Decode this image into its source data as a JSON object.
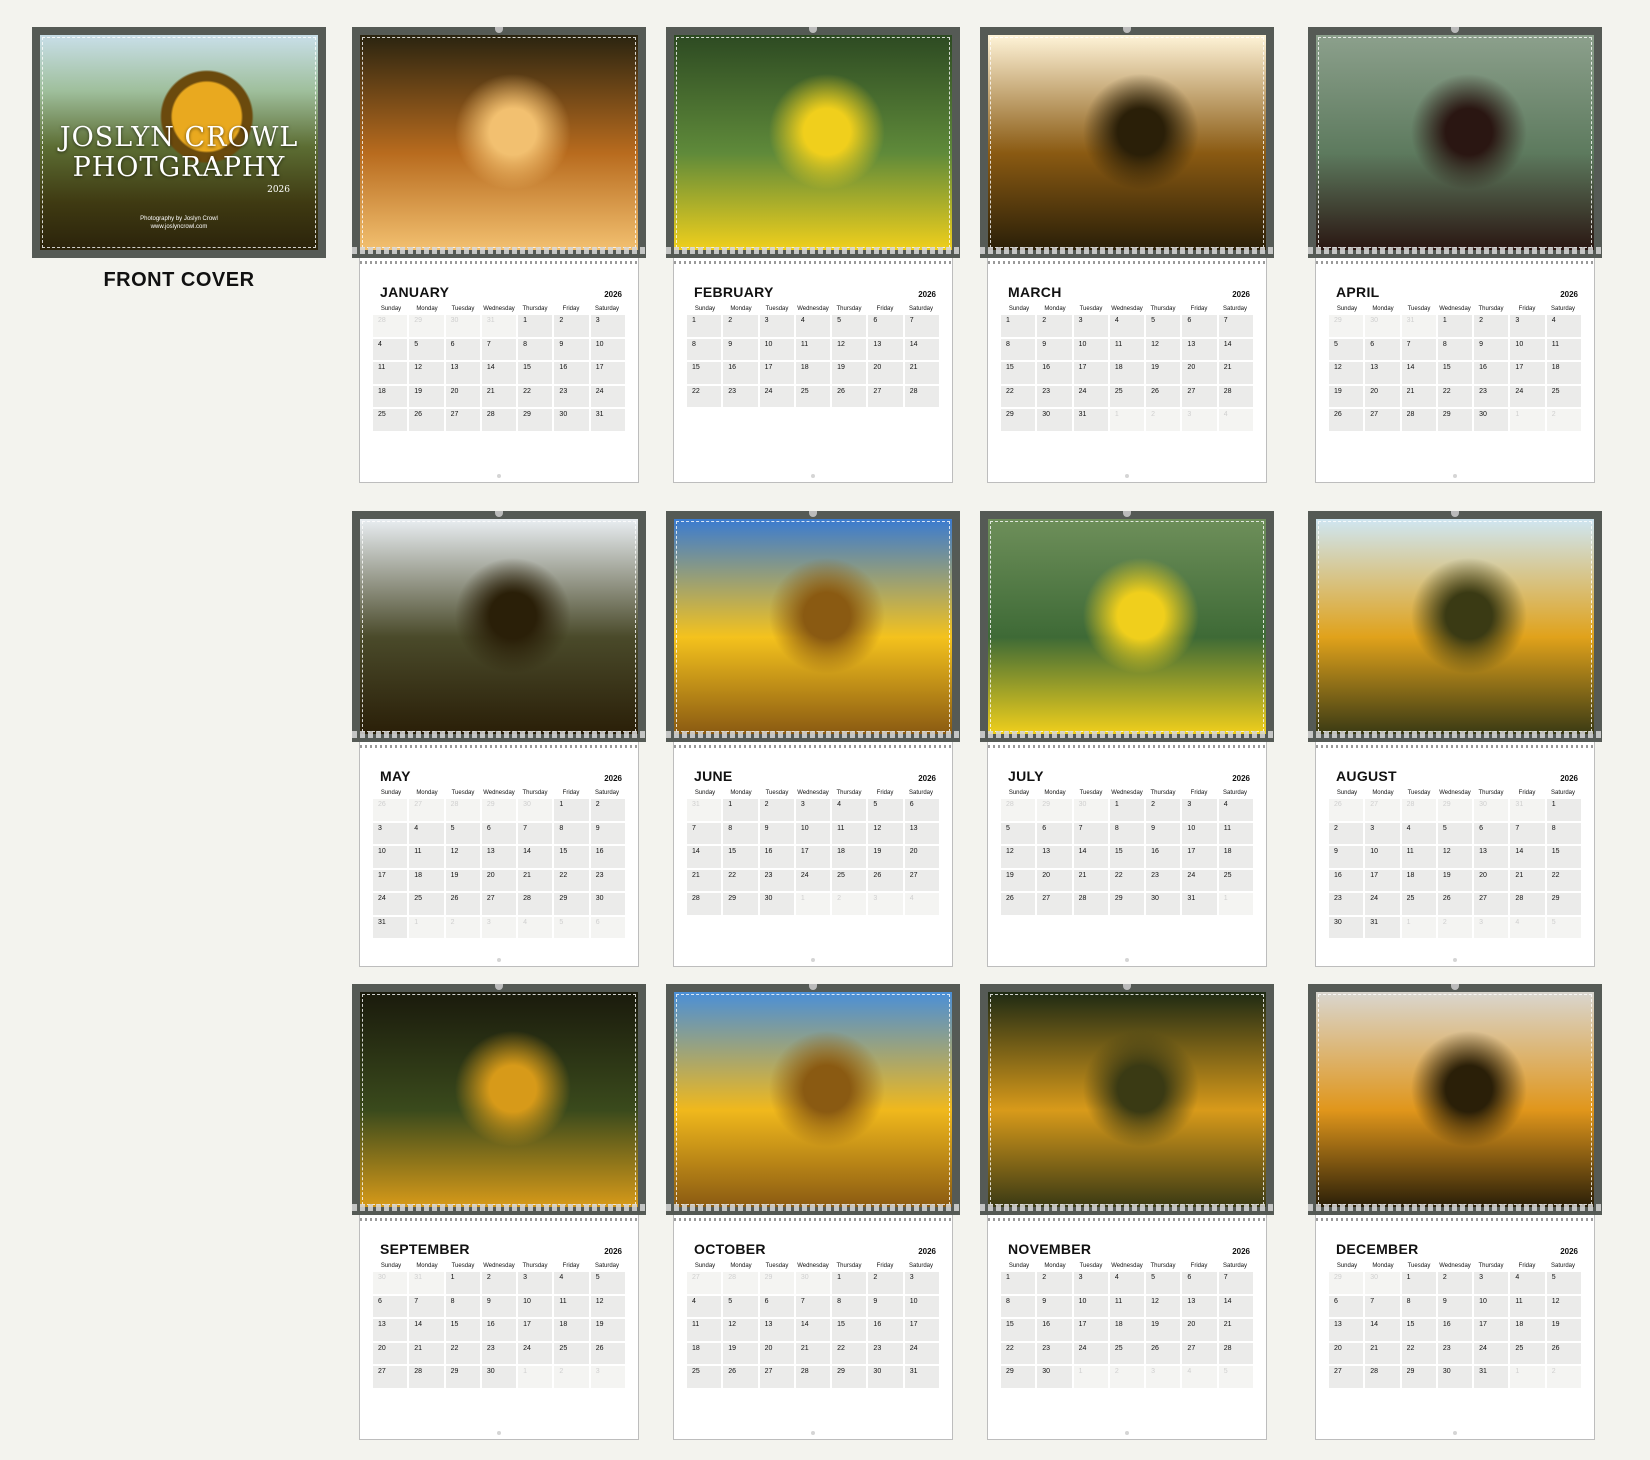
{
  "cover": {
    "title_line1": "JOSLYN CROWL",
    "title_line2": "PHOTGRAPHY",
    "year": "2026",
    "credit_line1": "Photography by Joslyn Crowl",
    "credit_line2": "www.joslyncrowl.com",
    "label": "FRONT COVER"
  },
  "weekdays": [
    "Sunday",
    "Monday",
    "Tuesday",
    "Wednesday",
    "Thursday",
    "Friday",
    "Saturday"
  ],
  "year": "2026",
  "months": [
    {
      "name": "JANUARY",
      "start": 4,
      "days": 31,
      "prev": 31,
      "photo": [
        "#2a2410",
        "#b86b1e",
        "#f2c070"
      ]
    },
    {
      "name": "FEBRUARY",
      "start": 0,
      "days": 28,
      "prev": 31,
      "photo": [
        "#2d4a22",
        "#5f8a3a",
        "#f0cf1c"
      ]
    },
    {
      "name": "MARCH",
      "start": 0,
      "days": 31,
      "prev": 28,
      "photo": [
        "#fff4d8",
        "#8a5a12",
        "#2a1f08"
      ]
    },
    {
      "name": "APRIL",
      "start": 3,
      "days": 30,
      "prev": 31,
      "photo": [
        "#8ca08c",
        "#5d7a5e",
        "#2a1612"
      ]
    },
    {
      "name": "MAY",
      "start": 5,
      "days": 31,
      "prev": 30,
      "photo": [
        "#e9eef2",
        "#4a4a2a",
        "#2a1f08"
      ]
    },
    {
      "name": "JUNE",
      "start": 1,
      "days": 30,
      "prev": 31,
      "photo": [
        "#3a7bd1",
        "#f4c21d",
        "#8a5a12"
      ]
    },
    {
      "name": "JULY",
      "start": 3,
      "days": 31,
      "prev": 30,
      "photo": [
        "#6e8f5a",
        "#3e6a36",
        "#f0cf1c"
      ]
    },
    {
      "name": "AUGUST",
      "start": 6,
      "days": 31,
      "prev": 31,
      "photo": [
        "#cfe6f2",
        "#e0a21b",
        "#3a3a14"
      ]
    },
    {
      "name": "SEPTEMBER",
      "start": 2,
      "days": 30,
      "prev": 31,
      "photo": [
        "#1a1a0c",
        "#3a4a1c",
        "#d79a19"
      ]
    },
    {
      "name": "OCTOBER",
      "start": 4,
      "days": 31,
      "prev": 30,
      "photo": [
        "#4a8fd8",
        "#f0b81c",
        "#8a5a12"
      ]
    },
    {
      "name": "NOVEMBER",
      "start": 0,
      "days": 30,
      "prev": 31,
      "photo": [
        "#1e2a14",
        "#d89a1a",
        "#3a3a14"
      ]
    },
    {
      "name": "DECEMBER",
      "start": 2,
      "days": 31,
      "prev": 30,
      "photo": [
        "#d9d6cf",
        "#e0961b",
        "#2a1f08"
      ]
    }
  ]
}
